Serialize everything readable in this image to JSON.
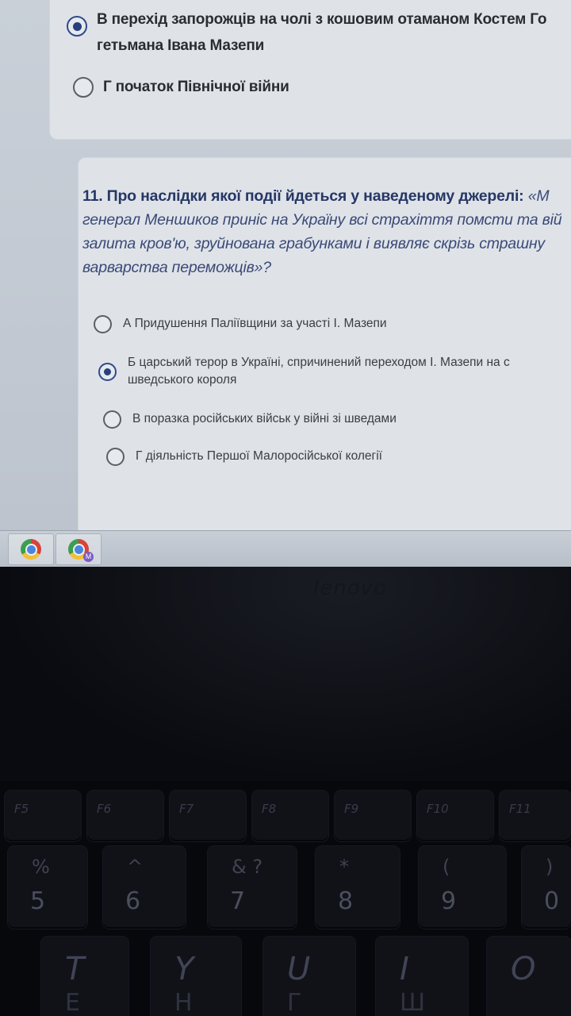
{
  "quiz": {
    "previous_question": {
      "options": [
        {
          "label": "В перехід запорожців на чолі з кошовим отаманом Костем Го",
          "label_line2": "гетьмана Івана Мазепи",
          "selected": true
        },
        {
          "label": "Г початок Північної війни",
          "selected": false
        }
      ]
    },
    "question_11": {
      "lead": "11. Про наслідки якої події йдеться у наведеному джерелі:",
      "quote_start": "«М",
      "quote_line2": "генерал Меншиков приніс на Україну всі страхіття помсти та вій",
      "quote_line3": "залита кров'ю, зруйнована грабунками і виявляє скрізь страшну",
      "quote_line4": "варварства переможців»?",
      "options": [
        {
          "label": "А Придушення Паліївщини за участі І. Мазепи",
          "selected": false
        },
        {
          "label": "Б царський терор в Україні, спричинений переходом І. Мазепи на с",
          "label_line2": "шведського короля",
          "selected": true
        },
        {
          "label": "В поразка російських військ у війні зі шведами",
          "selected": false
        },
        {
          "label": "Г діяльність Першої Малоросійської колегії",
          "selected": false
        }
      ]
    }
  },
  "taskbar": {
    "apps": [
      {
        "name": "chrome-icon"
      },
      {
        "name": "chrome-profile-icon",
        "badge": "M"
      }
    ]
  },
  "laptop": {
    "brand": "lenovo",
    "function_keys": [
      "F5",
      "F6",
      "F7",
      "F8",
      "F9",
      "F10",
      "F11"
    ],
    "number_keys": [
      {
        "symbol": "%",
        "number": "5"
      },
      {
        "symbol": "^",
        "number": "6"
      },
      {
        "symbol": "& ?",
        "number": "7"
      },
      {
        "symbol": "*",
        "number": "8"
      },
      {
        "symbol": "(",
        "number": "9"
      },
      {
        "symbol": ")",
        "number": "0"
      }
    ],
    "letter_keys": [
      {
        "latin": "T",
        "cyrillic": "Е"
      },
      {
        "latin": "Y",
        "cyrillic": "Н"
      },
      {
        "latin": "U",
        "cyrillic": "Г"
      },
      {
        "latin": "I",
        "cyrillic": "Ш"
      },
      {
        "latin": "O",
        "cyrillic": ""
      }
    ]
  }
}
